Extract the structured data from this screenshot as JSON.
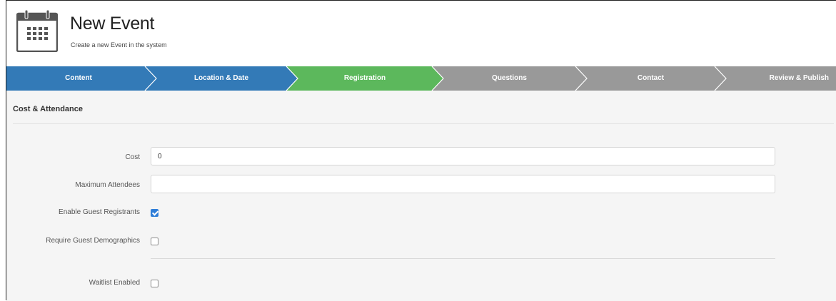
{
  "header": {
    "title": "New Event",
    "subtitle": "Create a new Event in the system",
    "icon": "calendar-icon"
  },
  "steps": [
    {
      "label": "Content",
      "state": "completed",
      "color": "#337ab7"
    },
    {
      "label": "Location & Date",
      "state": "completed",
      "color": "#337ab7"
    },
    {
      "label": "Registration",
      "state": "active",
      "color": "#5cb85c"
    },
    {
      "label": "Questions",
      "state": "pending",
      "color": "#999999"
    },
    {
      "label": "Contact",
      "state": "pending",
      "color": "#999999"
    },
    {
      "label": "Review & Publish",
      "state": "pending",
      "color": "#999999"
    }
  ],
  "section": {
    "title": "Cost & Attendance"
  },
  "form": {
    "cost": {
      "label": "Cost",
      "value": "0"
    },
    "max_attendees": {
      "label": "Maximum Attendees",
      "value": ""
    },
    "enable_guest": {
      "label": "Enable Guest Registrants",
      "checked": true
    },
    "require_guest_demo": {
      "label": "Require Guest Demographics",
      "checked": false
    },
    "waitlist": {
      "label": "Waitlist Enabled",
      "checked": false
    }
  }
}
